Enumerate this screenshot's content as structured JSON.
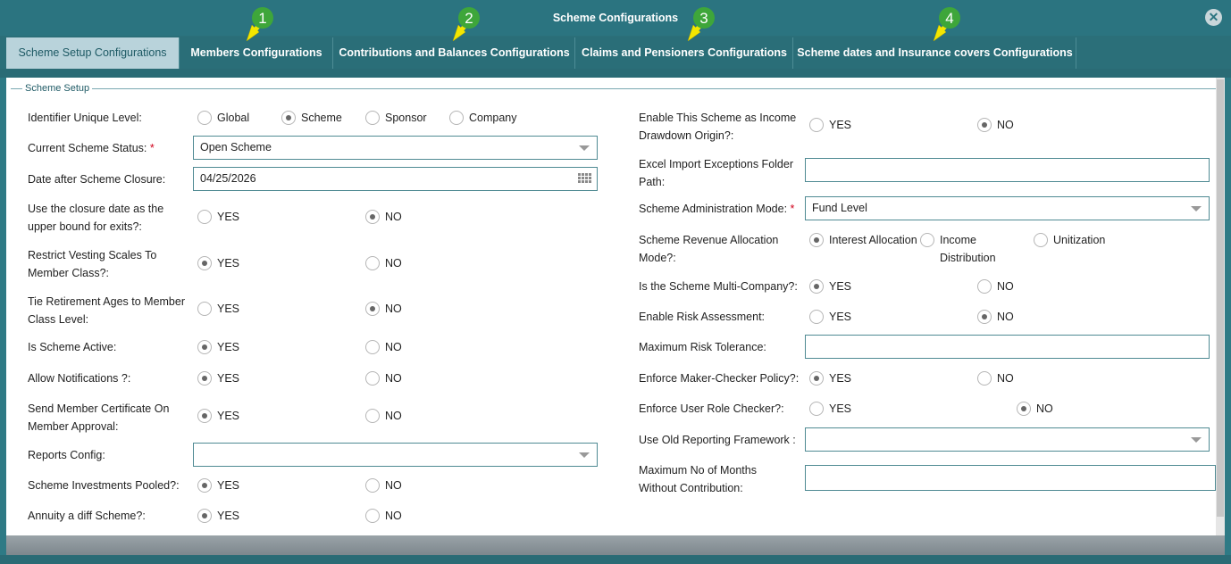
{
  "window": {
    "title": "Scheme Configurations"
  },
  "tabs": [
    {
      "label": "Scheme Setup Configurations"
    },
    {
      "label": "Members Configurations"
    },
    {
      "label": "Contributions and Balances Configurations"
    },
    {
      "label": "Claims and Pensioners Configurations"
    },
    {
      "label": "Scheme dates and Insurance covers Configurations"
    }
  ],
  "markers": [
    "1",
    "2",
    "3",
    "4"
  ],
  "section": {
    "legend": "Scheme Setup"
  },
  "left": {
    "identifier": {
      "label": "Identifier Unique Level:",
      "opts": [
        "Global",
        "Scheme",
        "Sponsor",
        "Company"
      ]
    },
    "status": {
      "label": "Current Scheme Status:",
      "req": "*",
      "value": "Open Scheme"
    },
    "closure": {
      "label": "Date after Scheme Closure:",
      "value": "04/25/2026"
    },
    "closure_bound": {
      "l1": "Use the closure date as the",
      "l2": "upper bound for exits?:"
    },
    "vesting": {
      "l1": "Restrict Vesting Scales To",
      "l2": "Member Class?:"
    },
    "retirement": {
      "l1": "Tie Retirement Ages to Member",
      "l2": "Class Level:"
    },
    "active": {
      "label": "Is Scheme Active:"
    },
    "notify": {
      "label": "Allow Notifications ?:"
    },
    "cert": {
      "l1": "Send Member Certificate On",
      "l2": "Member Approval:"
    },
    "reports": {
      "label": "Reports Config:",
      "value": ""
    },
    "pooled": {
      "label": "Scheme Investments Pooled?:"
    },
    "annuity": {
      "label": "Annuity a diff Scheme?:"
    }
  },
  "right": {
    "drawdown": {
      "l1": "Enable This Scheme as Income",
      "l2": "Drawdown Origin?:"
    },
    "excel": {
      "l1": "Excel Import Exceptions Folder",
      "l2": "Path:",
      "value": ""
    },
    "admin": {
      "label": "Scheme Administration Mode:",
      "req": "*",
      "value": "Fund Level"
    },
    "revenue": {
      "l1": "Scheme Revenue Allocation",
      "l2": "Mode?:",
      "opt1": "Interest Allocation",
      "opt2a": "Income",
      "opt2b": "Distribution",
      "opt3": "Unitization"
    },
    "multi": {
      "label": "Is the Scheme Multi-Company?:"
    },
    "risk": {
      "label": "Enable Risk Assessment:"
    },
    "tolerance": {
      "label": "Maximum Risk Tolerance:",
      "value": ""
    },
    "maker": {
      "label": "Enforce Maker-Checker Policy?:"
    },
    "role": {
      "label": "Enforce User Role Checker?:"
    },
    "oldrep": {
      "label": "Use Old Reporting Framework :",
      "value": ""
    },
    "months": {
      "l1": "Maximum No of Months",
      "l2": "Without Contribution:",
      "value": ""
    }
  },
  "yes": "YES",
  "no": "NO"
}
